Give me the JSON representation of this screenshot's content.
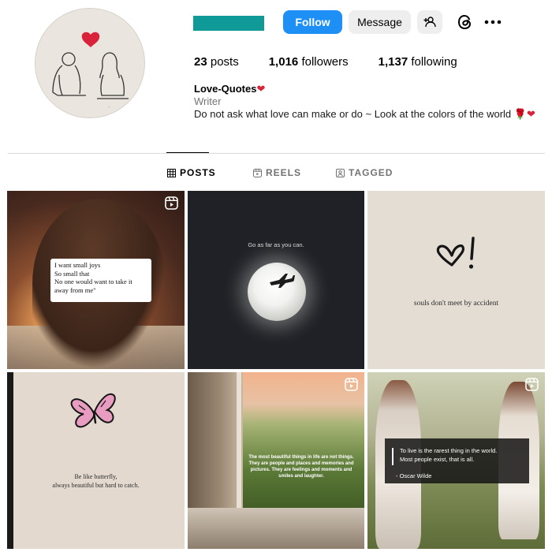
{
  "profile": {
    "follow_label": "Follow",
    "message_label": "Message",
    "stats": {
      "posts": "23",
      "posts_label": "posts",
      "followers": "1,016",
      "followers_label": "followers",
      "following": "1,137",
      "following_label": "following"
    },
    "bio": {
      "name": "Love-Quotes",
      "name_emoji": "❤",
      "category": "Writer",
      "text": "Do not ask what love can make or do ~ Look at the colors of the world",
      "text_emoji_1": "🌹",
      "text_emoji_2": "❤"
    }
  },
  "tabs": [
    {
      "label": "POSTS",
      "icon": "grid-icon",
      "active": true
    },
    {
      "label": "REELS",
      "icon": "reels-icon",
      "active": false
    },
    {
      "label": "TAGGED",
      "icon": "tagged-icon",
      "active": false
    }
  ],
  "posts": [
    {
      "type": "reel",
      "lines": [
        "I want small joys",
        "So small that",
        "No one would want to take it",
        "away from me\""
      ]
    },
    {
      "type": "image",
      "caption": "Go as far as you can."
    },
    {
      "type": "image",
      "caption": "souls don't meet by accident"
    },
    {
      "type": "image",
      "lines": [
        "Be like butterfly,",
        "always beautiful but hard to catch."
      ]
    },
    {
      "type": "reel",
      "lines": [
        "The most beautiful things in life are not things.",
        "They are people and places and memories and",
        "pictures. They are feelings and moments and",
        "smiles and laughter."
      ]
    },
    {
      "type": "reel",
      "lines": [
        "To live is the rarest thing in the world.",
        "Most people exist, that is all."
      ],
      "author": "- Oscar Wilde"
    }
  ],
  "colors": {
    "accent": "#1e90f5",
    "username_redacted": "#0f9a97",
    "divider": "#dbdbdb"
  }
}
